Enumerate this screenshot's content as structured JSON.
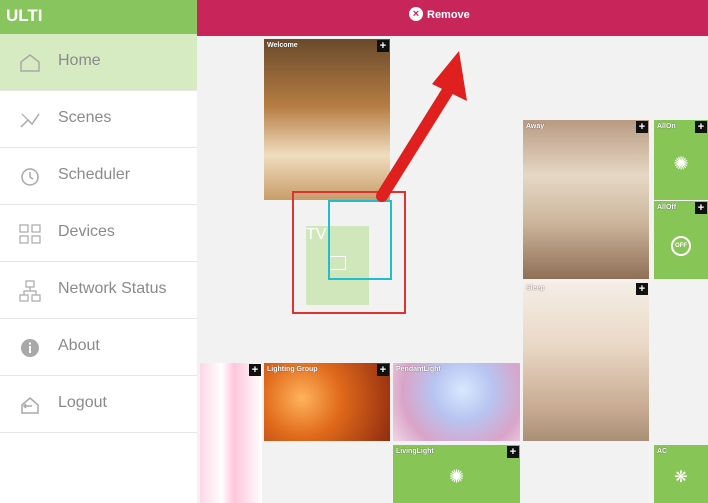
{
  "app": {
    "title": "ULTI"
  },
  "topbar": {
    "remove_label": "Remove"
  },
  "sidebar": {
    "items": [
      {
        "label": "Home",
        "icon": "home-icon",
        "active": true
      },
      {
        "label": "Scenes",
        "icon": "scenes-icon"
      },
      {
        "label": "Scheduler",
        "icon": "clock-icon"
      },
      {
        "label": "Devices",
        "icon": "devices-icon"
      },
      {
        "label": "Network Status",
        "icon": "network-icon"
      },
      {
        "label": "About",
        "icon": "info-icon"
      },
      {
        "label": "Logout",
        "icon": "logout-icon"
      }
    ]
  },
  "tiles": {
    "welcome": "Welcome",
    "tv": "TV",
    "away": "Away",
    "allon": "AllOn",
    "alloff": "AllOff",
    "sleep": "Sleep",
    "lighting": "Lighting Group",
    "pendant": "PendantLight",
    "living": "LivingLight",
    "ac": "AC"
  },
  "colors": {
    "brand_green": "#89c55f",
    "remove_bar": "#c8265a",
    "tile_green": "#88c557",
    "highlight_red": "#e13232",
    "highlight_blue": "#22bcd2"
  }
}
